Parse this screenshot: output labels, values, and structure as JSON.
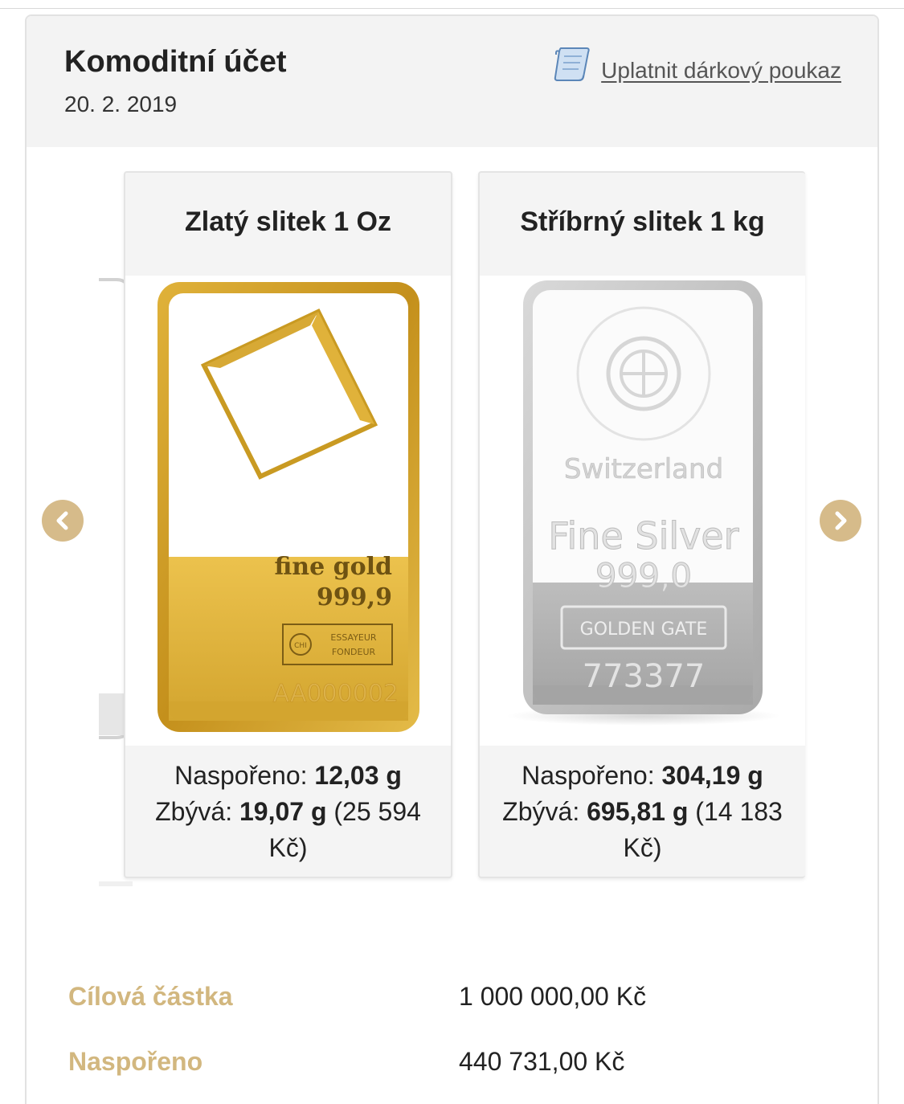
{
  "header": {
    "title": "Komoditní účet",
    "date": "20. 2. 2019",
    "voucher_label": "Uplatnit dárkový poukaz"
  },
  "cards": [
    {
      "title": "Zlatý slitek 1 Oz",
      "saved_label": "Naspořeno:",
      "saved_value": "12,03 g",
      "remaining_label": "Zbývá:",
      "remaining_value": "19,07 g",
      "remaining_price": "(25 594 Kč)",
      "bar_text": {
        "line1": "fine gold",
        "line2": "999,9",
        "stamp1": "ESSAYEUR",
        "stamp2": "FONDEUR",
        "stamp_logo": "CHI",
        "serial": "AA000002"
      },
      "color": "#c99a22"
    },
    {
      "title": "Stříbrný slitek 1 kg",
      "saved_label": "Naspořeno:",
      "saved_value": "304,19 g",
      "remaining_label": "Zbývá:",
      "remaining_value": "695,81 g",
      "remaining_price": "(14 183 Kč)",
      "bar_text": {
        "country": "Switzerland",
        "line1": "Fine Silver",
        "line2": "999,0",
        "stamp": "GOLDEN GATE",
        "serial": "773377"
      },
      "color": "#bdbdbd"
    }
  ],
  "summary": [
    {
      "label": "Cílová částka",
      "value": "1 000 000,00 Kč"
    },
    {
      "label": "Naspořeno",
      "value": "440 731,00 Kč"
    }
  ],
  "colors": {
    "accent": "#d2b77f",
    "arrow": "#d6bb8a",
    "header_bg": "#f3f3f3"
  }
}
